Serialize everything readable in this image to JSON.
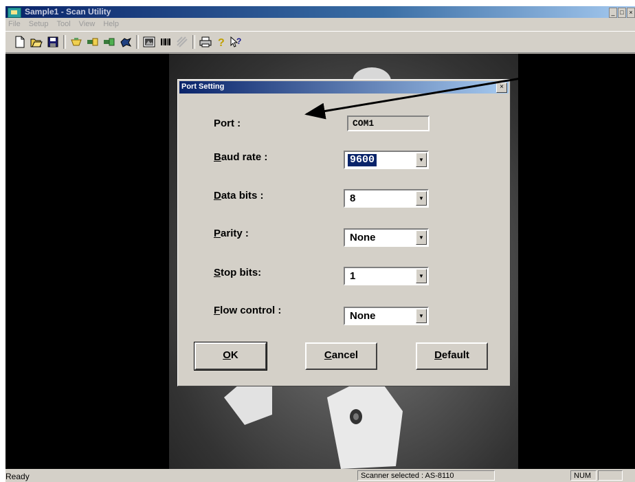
{
  "window": {
    "title": "Sample1 - Scan Utility",
    "caption_buttons": [
      "_",
      "□",
      "×"
    ]
  },
  "menu": [
    "File",
    "Setup",
    "Tool",
    "View",
    "Help"
  ],
  "toolbar": {
    "icons": [
      "new-icon",
      "open-icon",
      "save-icon",
      "scanner-icon",
      "port-icon",
      "port2-icon",
      "barcode-settings-icon",
      "preview-icon",
      "barcode-icon",
      "disabled-icon",
      "print-icon",
      "help-icon",
      "context-help-icon"
    ]
  },
  "dialog": {
    "title": "Port Setting",
    "close": "×",
    "port": {
      "label": "Port :",
      "value": "COM1"
    },
    "baud": {
      "mnemonic": "B",
      "label_rest": "aud rate :",
      "value": "9600"
    },
    "data_bits": {
      "mnemonic": "D",
      "label_rest": "ata bits :",
      "value": "8"
    },
    "parity": {
      "mnemonic": "P",
      "label_rest": "arity :",
      "value": "None"
    },
    "stop_bits": {
      "mnemonic": "S",
      "label_rest": "top bits:",
      "value": "1"
    },
    "flow": {
      "mnemonic": "F",
      "label_rest": "low control :",
      "value": "None"
    },
    "ok": {
      "mnemonic": "O",
      "rest": "K"
    },
    "cancel": {
      "mnemonic": "C",
      "rest": "ancel"
    },
    "default": {
      "mnemonic": "D",
      "rest": "efault"
    }
  },
  "status": {
    "left": "Ready",
    "scanner": "Scanner selected :  AS-8110",
    "num": "NUM"
  }
}
